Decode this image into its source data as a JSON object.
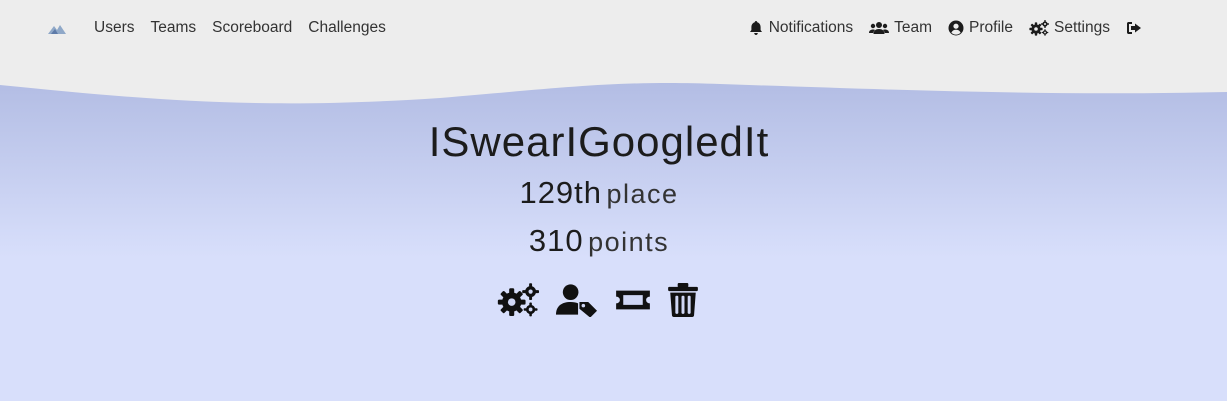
{
  "nav": {
    "left": [
      {
        "label": "Users"
      },
      {
        "label": "Teams"
      },
      {
        "label": "Scoreboard"
      },
      {
        "label": "Challenges"
      }
    ],
    "right": [
      {
        "label": "Notifications",
        "icon": "bell-icon"
      },
      {
        "label": "Team",
        "icon": "users-icon"
      },
      {
        "label": "Profile",
        "icon": "user-circle-icon"
      },
      {
        "label": "Settings",
        "icon": "cogs-icon"
      },
      {
        "label": "",
        "icon": "logout-icon"
      }
    ]
  },
  "team": {
    "name": "ISwearIGoogledIt",
    "place_value": "129th",
    "place_suffix": "place",
    "points_value": "310",
    "points_suffix": "points"
  },
  "actions": [
    {
      "icon": "cogs-icon"
    },
    {
      "icon": "user-tag-icon"
    },
    {
      "icon": "ticket-icon"
    },
    {
      "icon": "trash-icon"
    }
  ],
  "colors": {
    "nav_bg": "#ededed",
    "hero_top": "#b3bde4",
    "hero_bottom": "#d8dffb",
    "text": "#1c1c1c"
  }
}
